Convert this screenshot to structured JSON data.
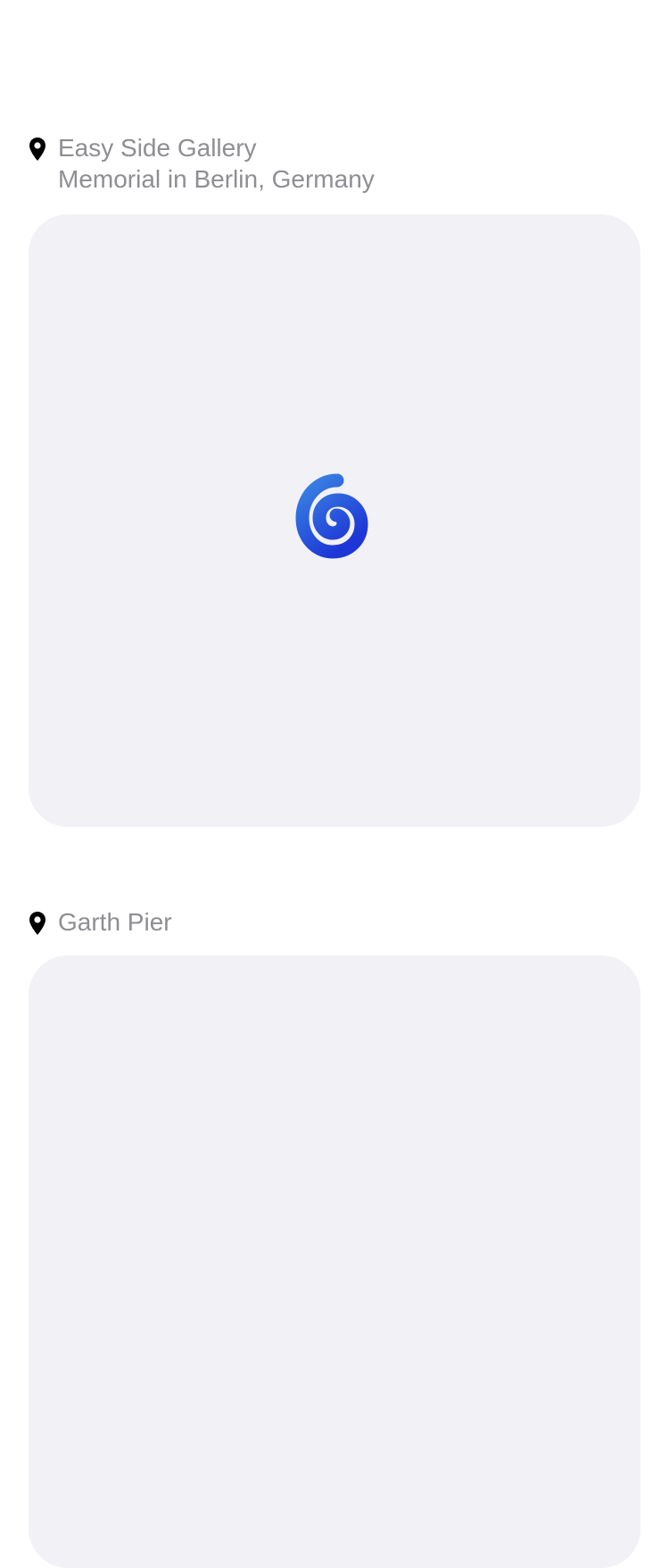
{
  "posts": [
    {
      "location": {
        "name": "Easy Side Gallery",
        "subtitle": "Memorial in Berlin, Germany",
        "icon": "map-pin-icon"
      },
      "media": {
        "state": "loading",
        "icon": "spiral-loader-icon",
        "loader_colors": [
          "#3b7be0",
          "#1f3fd6"
        ]
      }
    },
    {
      "location": {
        "name": "Garth Pier",
        "icon": "map-pin-icon"
      },
      "media": {
        "state": "loading"
      }
    }
  ],
  "colors": {
    "location_text": "#8e8e93",
    "card_background": "#f1f1f6"
  }
}
